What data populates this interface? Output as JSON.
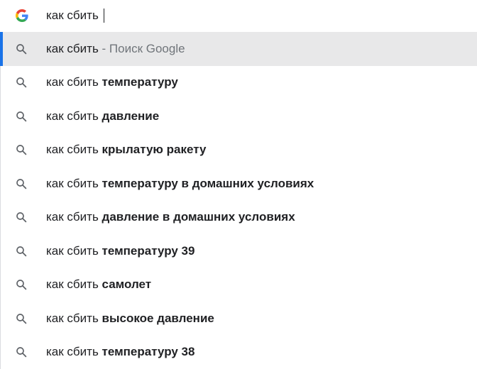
{
  "omnibox": {
    "query": "как сбить",
    "logo_icon": "google-g-icon"
  },
  "colors": {
    "selected_bg": "#e8e8e9",
    "selected_accent": "#1a73e8",
    "text": "#202124",
    "hint": "#70757a"
  },
  "suggestions": [
    {
      "prefix": "как сбить",
      "bold": "",
      "hint": " - Поиск Google",
      "icon": "search-icon"
    },
    {
      "prefix": "как сбить ",
      "bold": "температуру",
      "hint": "",
      "icon": "search-icon"
    },
    {
      "prefix": "как сбить ",
      "bold": "давление",
      "hint": "",
      "icon": "search-icon"
    },
    {
      "prefix": "как сбить ",
      "bold": "крылатую ракету",
      "hint": "",
      "icon": "search-icon"
    },
    {
      "prefix": "как сбить ",
      "bold": "температуру в домашних условиях",
      "hint": "",
      "icon": "search-icon"
    },
    {
      "prefix": "как сбить ",
      "bold": "давление в домашних условиях",
      "hint": "",
      "icon": "search-icon"
    },
    {
      "prefix": "как сбить ",
      "bold": "температуру 39",
      "hint": "",
      "icon": "search-icon"
    },
    {
      "prefix": "как сбить ",
      "bold": "самолет",
      "hint": "",
      "icon": "search-icon"
    },
    {
      "prefix": "как сбить ",
      "bold": "высокое давление",
      "hint": "",
      "icon": "search-icon"
    },
    {
      "prefix": "как сбить ",
      "bold": "температуру 38",
      "hint": "",
      "icon": "search-icon"
    }
  ]
}
